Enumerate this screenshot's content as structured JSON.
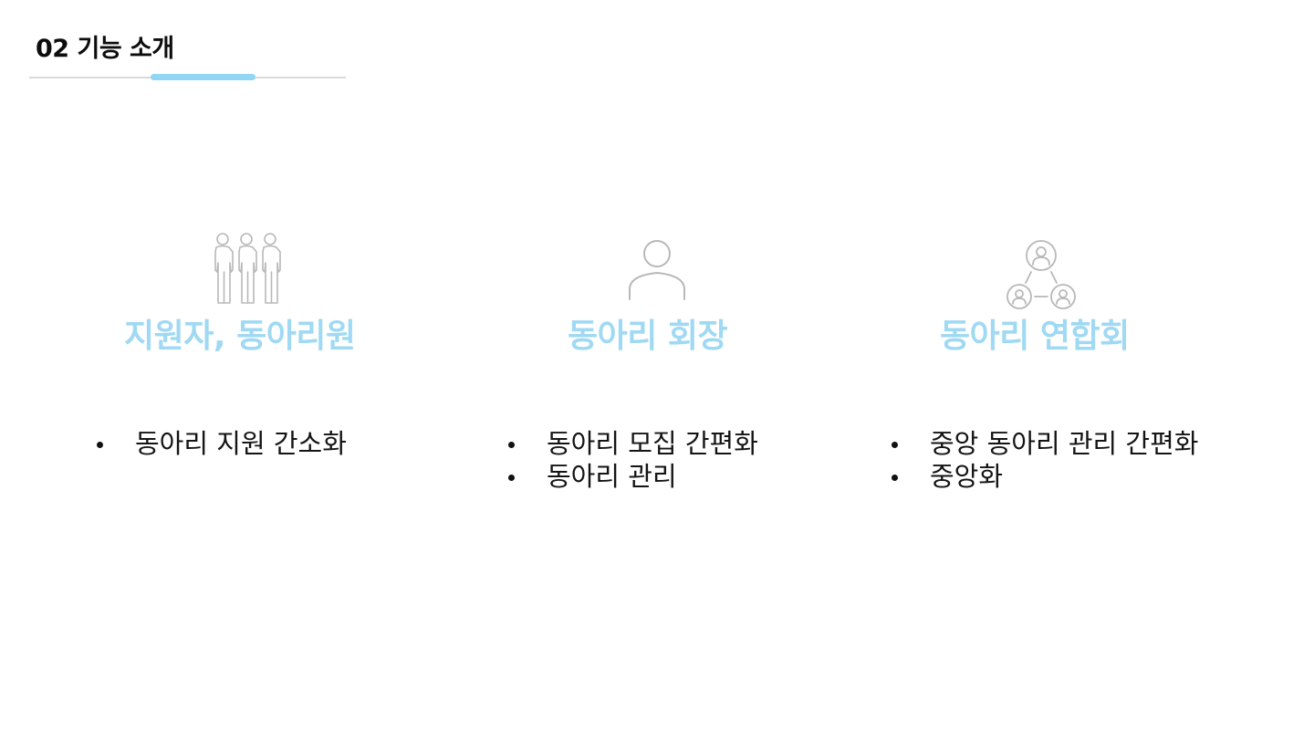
{
  "header": {
    "title": "02 기능 소개"
  },
  "colors": {
    "accent": "#92d6f5",
    "title_blue": "#9fd9f3",
    "icon_gray": "#b8b8b8",
    "rule_gray": "#d9d9d9"
  },
  "columns": [
    {
      "icon": "group-people-icon",
      "title": "지원자, 동아리원",
      "bullets": [
        "동아리 지원 간소화"
      ]
    },
    {
      "icon": "person-icon",
      "title": "동아리 회장",
      "bullets": [
        "동아리 모집 간편화",
        "동아리 관리"
      ]
    },
    {
      "icon": "network-people-icon",
      "title": "동아리 연합회",
      "bullets": [
        "중앙 동아리 관리 간편화",
        "중앙화"
      ]
    }
  ]
}
